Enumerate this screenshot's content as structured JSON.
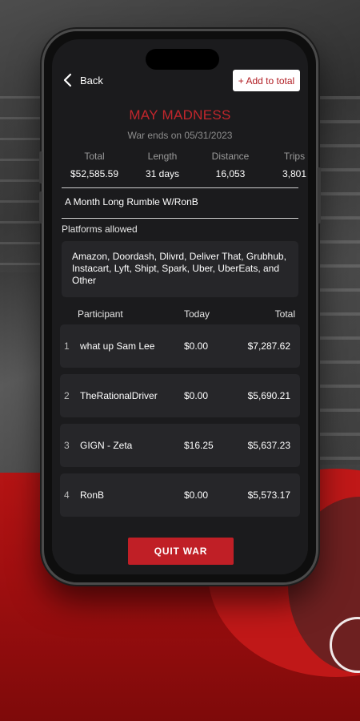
{
  "header": {
    "back_label": "Back",
    "add_total_label": "+ Add to total"
  },
  "war": {
    "title": "MAY MADNESS",
    "ends": "War ends on 05/31/2023",
    "description": "A Month Long Rumble W/RonB"
  },
  "stats": [
    {
      "label": "Total",
      "value": "$52,585.59"
    },
    {
      "label": "Length",
      "value": "31 days"
    },
    {
      "label": "Distance",
      "value": "16,053"
    },
    {
      "label": "Trips",
      "value": "3,801"
    }
  ],
  "platforms": {
    "label": "Platforms allowed",
    "list": "Amazon, Doordash, Dlivrd, Deliver That, Grubhub, Instacart, Lyft, Shipt, Spark, Uber, UberEats, and Other"
  },
  "table": {
    "headers": {
      "participant": "Participant",
      "today": "Today",
      "total": "Total"
    },
    "rows": [
      {
        "rank": "1",
        "name": "what up Sam Lee",
        "today": "$0.00",
        "total": "$7,287.62"
      },
      {
        "rank": "2",
        "name": "TheRationalDriver",
        "today": "$0.00",
        "total": "$5,690.21"
      },
      {
        "rank": "3",
        "name": "GIGN - Zeta",
        "today": "$16.25",
        "total": "$5,637.23"
      },
      {
        "rank": "4",
        "name": "RonB",
        "today": "$0.00",
        "total": "$5,573.17"
      }
    ]
  },
  "actions": {
    "quit_label": "QUIT WAR"
  },
  "colors": {
    "accent": "#c01f26",
    "background": "#1b1b1d",
    "card": "#262629"
  }
}
